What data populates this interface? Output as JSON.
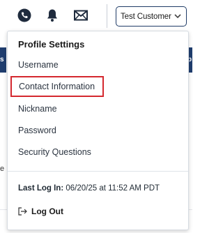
{
  "header": {
    "user_select_value": "Test Customer"
  },
  "background": {
    "nav_left_fragment": "s",
    "nav_right_fragment": "p",
    "text_fragment": "e"
  },
  "dropdown": {
    "title": "Profile Settings",
    "items": [
      {
        "label": "Username"
      },
      {
        "label": "Contact Information",
        "highlighted": true
      },
      {
        "label": "Nickname"
      },
      {
        "label": "Password"
      },
      {
        "label": "Security Questions"
      }
    ],
    "last_login_label": "Last Log In:",
    "last_login_value": "06/20/25 at 11:52 AM PDT",
    "logout_label": "Log Out"
  },
  "colors": {
    "icon": "#1f2b3d",
    "highlight_border": "#d4282f",
    "nav_bg": "#1f3d6e",
    "select_border": "#1f3b66"
  }
}
